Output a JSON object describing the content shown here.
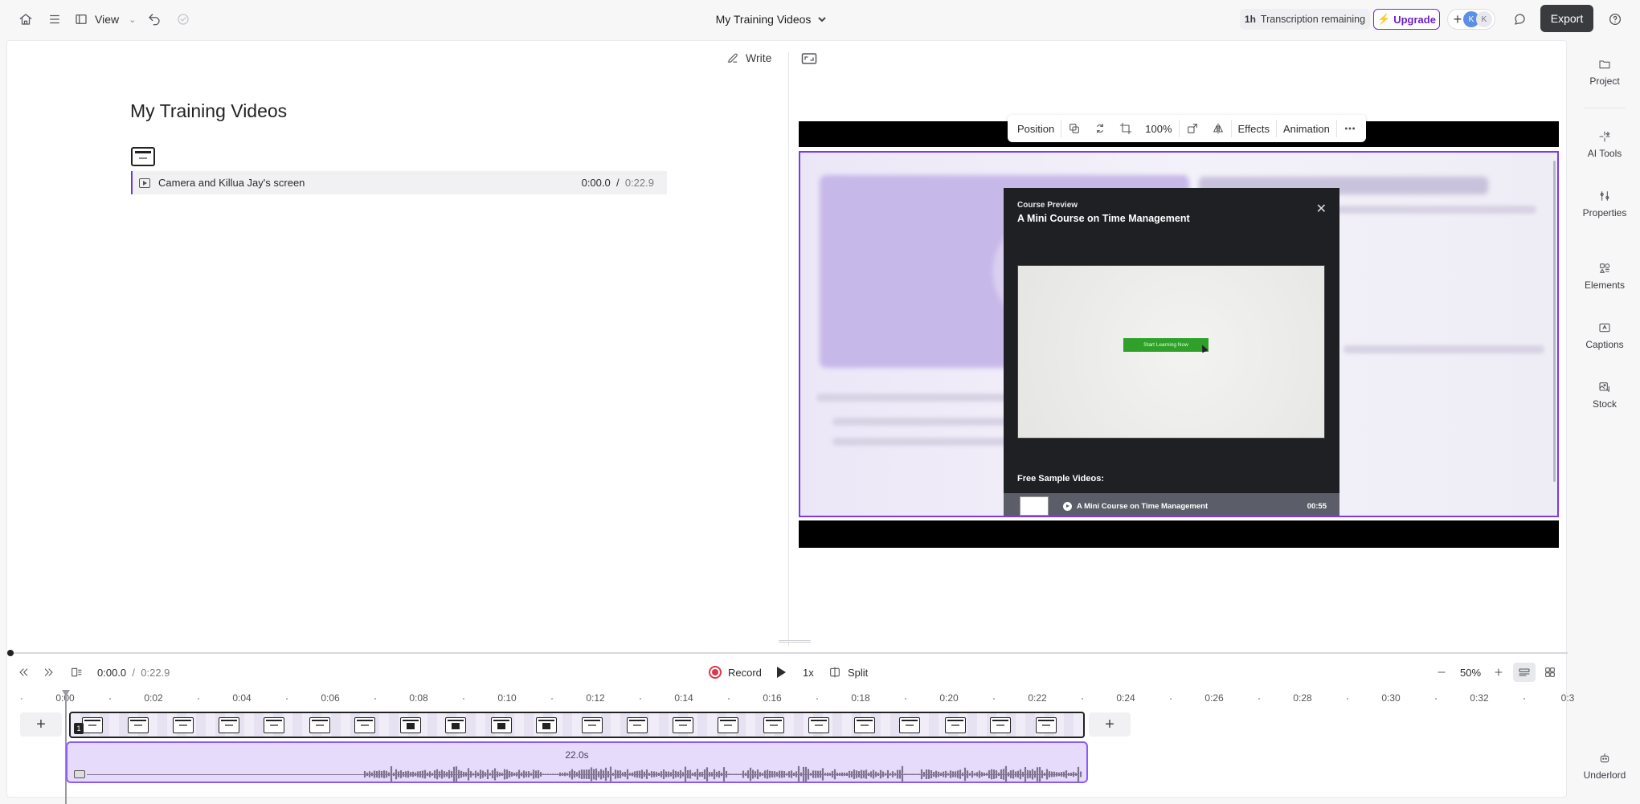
{
  "topbar": {
    "view_label": "View",
    "project_title": "My Training Videos",
    "transcription_amount": "1h",
    "transcription_label": "Transcription remaining",
    "upgrade_label": "Upgrade",
    "avatar1": "K",
    "avatar2": "K",
    "export_label": "Export"
  },
  "sidebar": {
    "items": [
      {
        "label": "Project",
        "icon": "folder-icon"
      },
      {
        "label": "AI Tools",
        "icon": "sparkle-icon"
      },
      {
        "label": "Properties",
        "icon": "sliders-icon"
      },
      {
        "label": "Elements",
        "icon": "shapes-icon"
      },
      {
        "label": "Captions",
        "icon": "captions-icon"
      },
      {
        "label": "Stock",
        "icon": "stock-icon"
      }
    ],
    "underlord_label": "Underlord"
  },
  "script": {
    "write_label": "Write",
    "doc_title": "My Training Videos",
    "clip_label": "Camera and Killua Jay's screen",
    "clip_current": "0:00.0",
    "clip_separator": "/",
    "clip_total": "0:22.9"
  },
  "canvas_toolbar": {
    "position_label": "Position",
    "zoom_label": "100%",
    "effects_label": "Effects",
    "animation_label": "Animation"
  },
  "preview": {
    "label": "Course Preview",
    "title": "A Mini Course on Time Management",
    "cta": "Start Learning Now",
    "free_label": "Free Sample Videos:",
    "row_title": "A Mini Course on Time Management",
    "row_duration": "00:55"
  },
  "playback": {
    "current": "0:00.0",
    "separator": "/",
    "total": "0:22.9",
    "record_label": "Record",
    "speed_label": "1x",
    "split_label": "Split",
    "zoom_label": "50%"
  },
  "ruler": {
    "ticks": [
      "0:00",
      "0:02",
      "0:04",
      "0:06",
      "0:08",
      "0:10",
      "0:12",
      "0:14",
      "0:16",
      "0:18",
      "0:20",
      "0:22",
      "0:24",
      "0:26",
      "0:28",
      "0:30",
      "0:32",
      "0:3"
    ]
  },
  "tracks": {
    "video_badge": "1",
    "audio_duration": "22.0s"
  },
  "colors": {
    "accent": "#7c3aed",
    "upgrade": "#6d1fc9",
    "record": "#e0364b",
    "annotation_arrow": "#e8403a"
  }
}
